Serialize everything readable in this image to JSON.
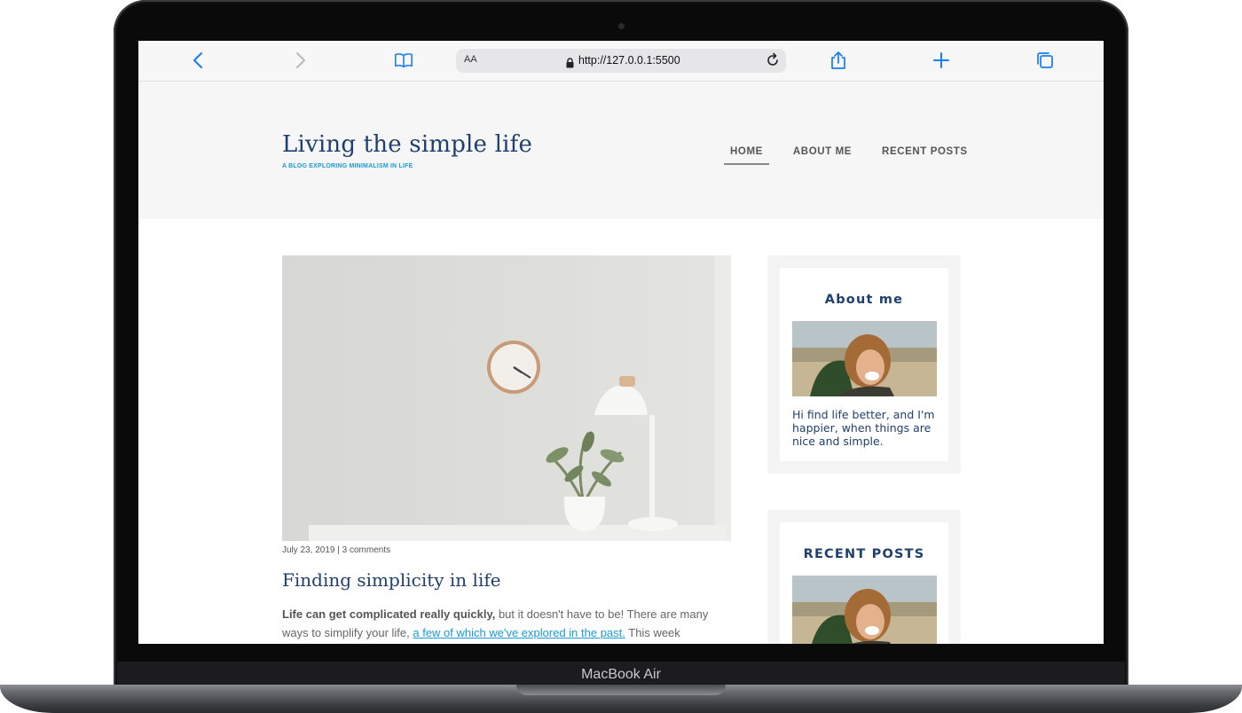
{
  "device": {
    "label": "MacBook Air"
  },
  "browser": {
    "text_size_label": "AA",
    "url": "http://127.0.0.1:5500"
  },
  "site": {
    "title": "Living the simple life",
    "tagline": "A BLOG EXPLORING MINIMALISM IN LIFE",
    "nav": [
      {
        "label": "HOME",
        "active": true
      },
      {
        "label": "ABOUT ME",
        "active": false
      },
      {
        "label": "RECENT POSTS",
        "active": false
      }
    ]
  },
  "post": {
    "meta": "July 23, 2019 | 3 comments",
    "title": "Finding simplicity in life",
    "excerpt_bold": "Life can get complicated really quickly,",
    "excerpt_1": " but it doesn't have to be! There are many ways to simplify your life, ",
    "excerpt_link": "a few of which we've explored in the past.",
    "excerpt_2": " This week"
  },
  "sidebar": {
    "about": {
      "title": "About me",
      "text": "Hi find life better, and I'm happier, when things are nice and simple."
    },
    "recent": {
      "title": "RECENT POSTS"
    }
  },
  "colors": {
    "brand_navy": "#1f3f6e",
    "link_blue": "#1a9ad6",
    "safari_blue": "#1a7cf0"
  },
  "icons": [
    "back-icon",
    "forward-icon",
    "bookmarks-icon",
    "lock-icon",
    "reload-icon",
    "share-icon",
    "new-tab-icon",
    "tabs-icon"
  ]
}
